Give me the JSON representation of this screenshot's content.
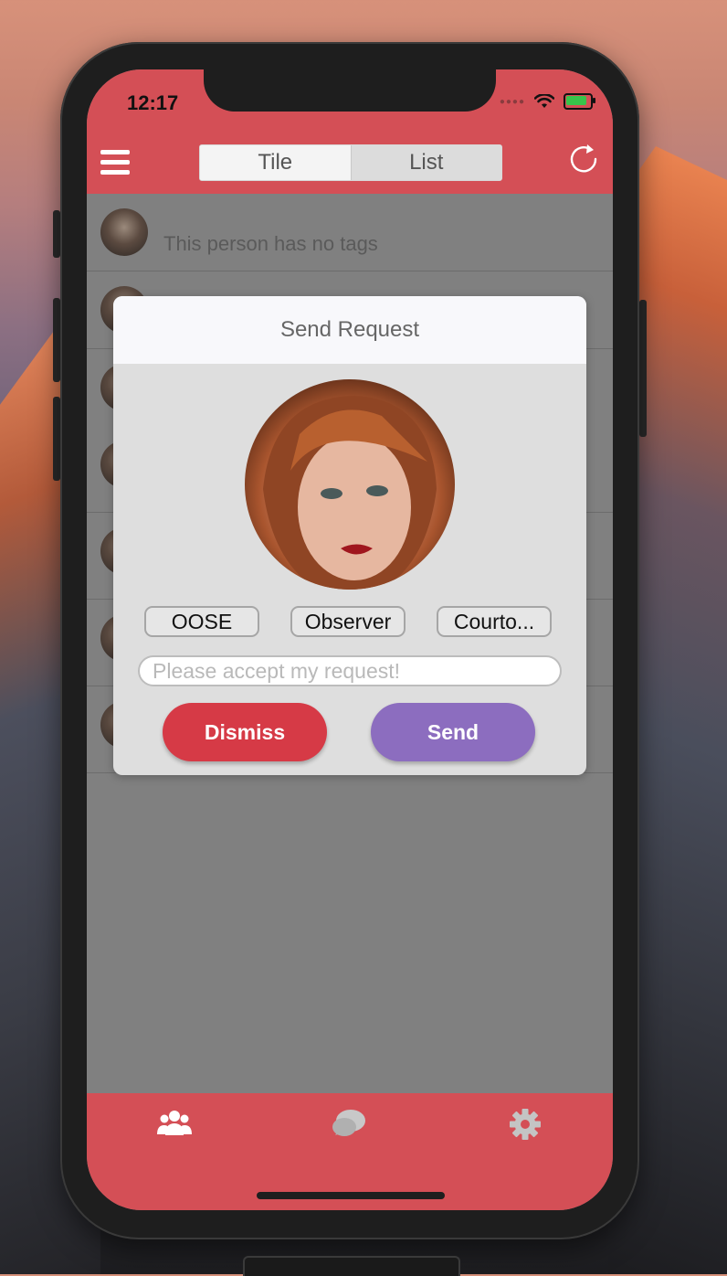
{
  "status_bar": {
    "time": "12:17"
  },
  "header": {
    "segments": [
      {
        "label": "Tile",
        "selected": true
      },
      {
        "label": "List",
        "selected": false
      }
    ]
  },
  "list": {
    "rows": [
      {
        "text": "This person has no tags"
      }
    ]
  },
  "modal": {
    "title": "Send Request",
    "tags": [
      "OOSE",
      "Observer",
      "Courto..."
    ],
    "message_placeholder": "Please accept my request!",
    "dismiss_label": "Dismiss",
    "send_label": "Send"
  },
  "tabbar": {
    "icons": [
      "people-icon",
      "chat-bubble-icon",
      "gear-icon"
    ]
  },
  "colors": {
    "accent": "#d44f56",
    "dismiss": "#d63a46",
    "send": "#8c6dbf",
    "overlay_gray": "#808080"
  }
}
